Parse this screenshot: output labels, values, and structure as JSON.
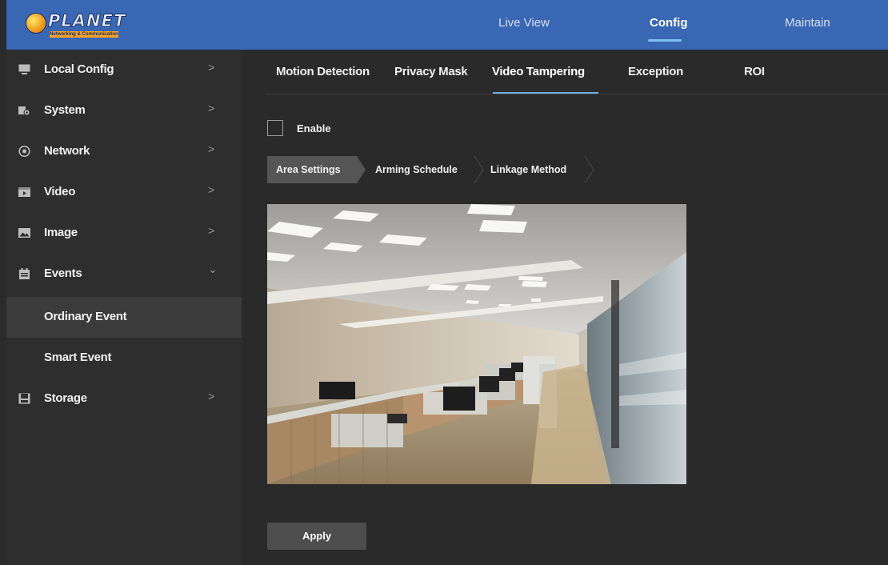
{
  "brand": {
    "name": "PLANET",
    "tagline": "Networking & Communication"
  },
  "topnav": [
    {
      "label": "Live View"
    },
    {
      "label": "Config"
    },
    {
      "label": "Maintain"
    }
  ],
  "sidebar": {
    "items": [
      {
        "label": "Local Config",
        "icon": "monitor-icon"
      },
      {
        "label": "System",
        "icon": "system-icon"
      },
      {
        "label": "Network",
        "icon": "network-icon"
      },
      {
        "label": "Video",
        "icon": "video-icon"
      },
      {
        "label": "Image",
        "icon": "image-icon"
      },
      {
        "label": "Events",
        "icon": "events-icon"
      },
      {
        "label": "Ordinary Event"
      },
      {
        "label": "Smart Event"
      },
      {
        "label": "Storage",
        "icon": "storage-icon"
      }
    ]
  },
  "tabs": [
    {
      "label": "Motion Detection"
    },
    {
      "label": "Privacy Mask"
    },
    {
      "label": "Video Tampering"
    },
    {
      "label": "Exception"
    },
    {
      "label": "ROI"
    }
  ],
  "enable": {
    "label": "Enable",
    "checked": false
  },
  "steps": [
    {
      "label": "Area Settings"
    },
    {
      "label": "Arming Schedule"
    },
    {
      "label": "Linkage Method"
    }
  ],
  "apply_label": "Apply",
  "colors": {
    "header": "#3a67b4",
    "accent": "#6fb0e6",
    "sidebar": "#2e2e2e",
    "main": "#2a2a2a"
  }
}
